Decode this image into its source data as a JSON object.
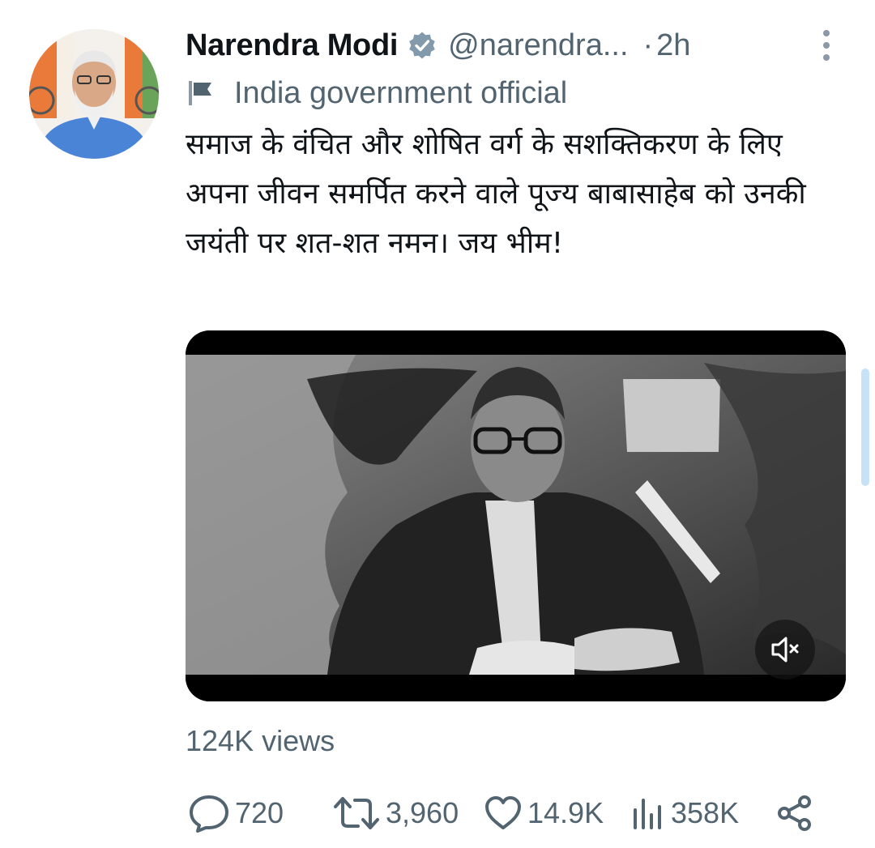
{
  "tweet": {
    "author_name": "Narendra Modi",
    "handle": "@narendra...",
    "separator": "·",
    "time": "2h",
    "label": "India government official",
    "text": "समाज के वंचित और शोषित वर्ग के सशक्तिकरण के लिए अपना जीवन समर्पित करने वाले पूज्य बाबासाहेब को उनकी जयंती पर शत-शत नमन। जय भीम!",
    "views": "124K views"
  },
  "actions": {
    "replies": "720",
    "retweets": "3,960",
    "likes": "14.9K",
    "analytics": "358K"
  },
  "icons": {
    "verified": "verified-badge-icon",
    "label": "flag-icon",
    "more": "more-options-icon",
    "reply": "reply-icon",
    "retweet": "retweet-icon",
    "like": "heart-icon",
    "analytics": "analytics-icon",
    "share": "share-icon",
    "mute": "volume-muted-icon"
  },
  "colors": {
    "text_primary": "#0f1419",
    "text_secondary": "#536471",
    "verified_badge": "#829aab"
  }
}
